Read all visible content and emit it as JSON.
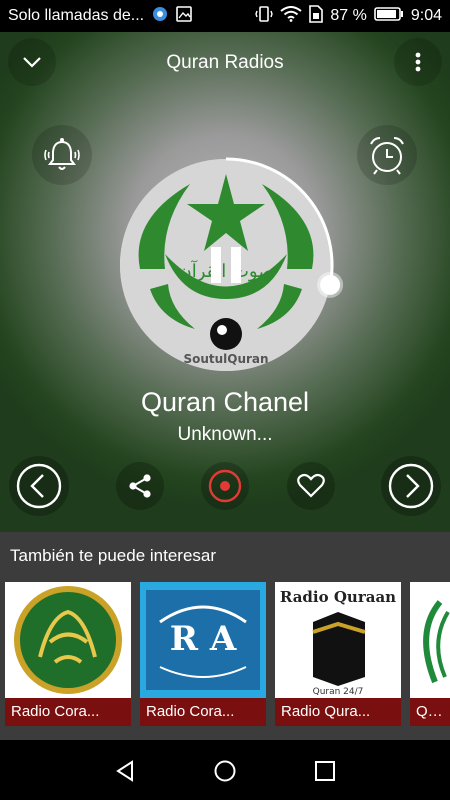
{
  "status_bar": {
    "carrier": "Solo llamadas de...",
    "battery": "87 %",
    "time": "9:04"
  },
  "header": {
    "title": "Quran Radios",
    "collapse_icon": "chevron-down-icon",
    "menu_icon": "more-vert-icon"
  },
  "player": {
    "alarm_icon": "bell-icon",
    "timer_icon": "alarm-clock-icon",
    "artwork_text": "SoutulQuran",
    "station_name": "Quran Chanel",
    "track": "Unknown...",
    "progress": 0.28,
    "state": "playing",
    "controls": [
      "previous",
      "share",
      "record",
      "favorite",
      "next"
    ]
  },
  "suggestions": {
    "title": "También te puede interesar",
    "items": [
      {
        "label": "Radio Cora..."
      },
      {
        "label": "Radio Cora..."
      },
      {
        "label": "Radio Qura...",
        "art_title": "Radio Quraan",
        "art_sub": "Quran 24/7"
      },
      {
        "label": "Qura"
      }
    ]
  },
  "colors": {
    "caption_bg": "#7a0f0f",
    "record": "#e53935",
    "player_bg_outer": "#1f3d1c",
    "suggest_bg": "#3c3c3c"
  }
}
